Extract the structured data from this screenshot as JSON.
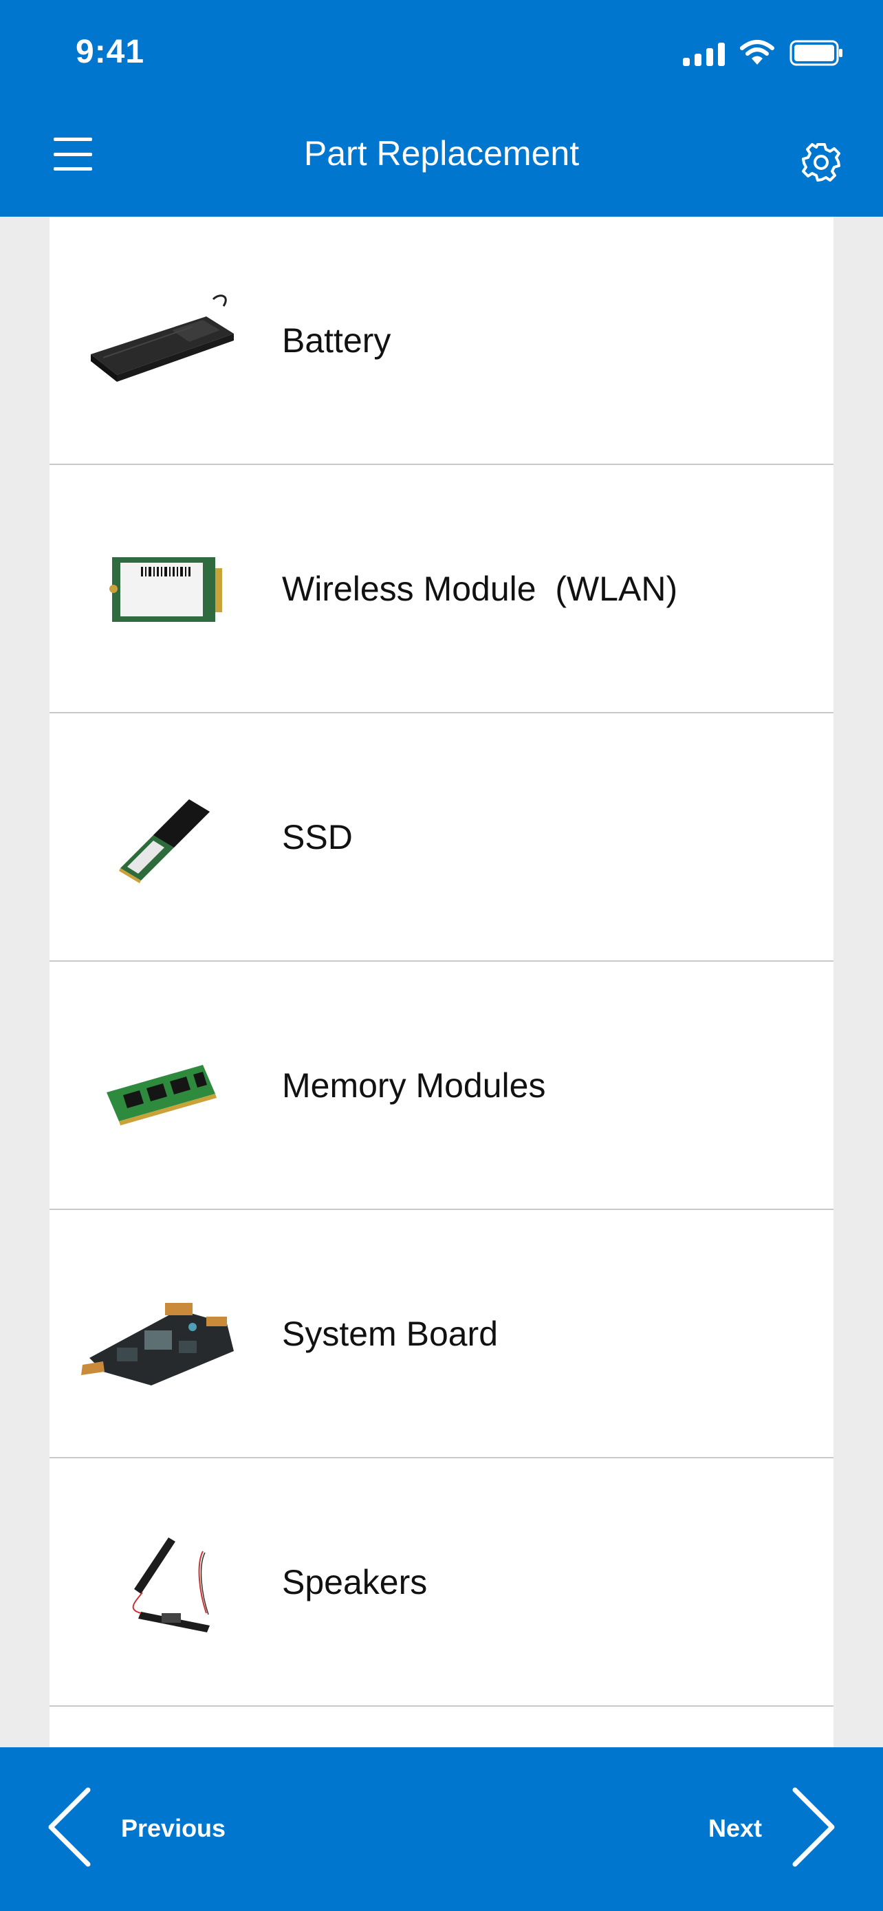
{
  "status_bar": {
    "time": "9:41"
  },
  "header": {
    "title": "Part Replacement"
  },
  "parts": [
    {
      "label": "Battery",
      "icon": "battery-part-image"
    },
    {
      "label": "Wireless Module  (WLAN)",
      "icon": "wlan-card-image"
    },
    {
      "label": "SSD",
      "icon": "ssd-image"
    },
    {
      "label": "Memory Modules",
      "icon": "memory-module-image"
    },
    {
      "label": "System Board",
      "icon": "system-board-image"
    },
    {
      "label": "Speakers",
      "icon": "speakers-image"
    }
  ],
  "footer": {
    "previous_label": "Previous",
    "next_label": "Next"
  },
  "colors": {
    "brand_blue": "#0076ce",
    "background": "#ececec",
    "divider": "#c9c9c9"
  }
}
